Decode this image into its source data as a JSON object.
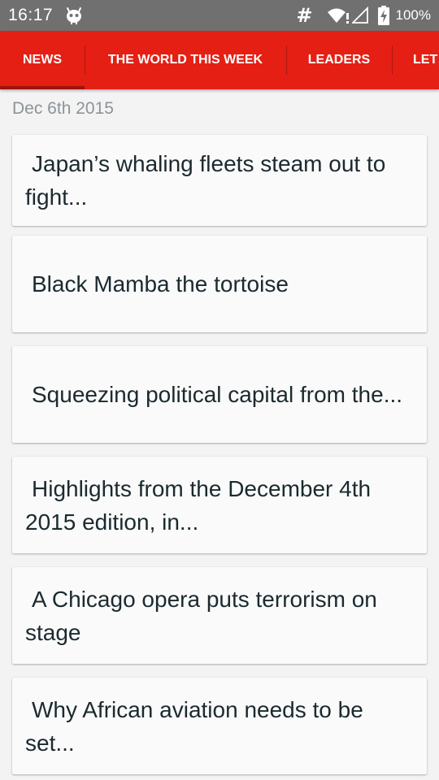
{
  "status_bar": {
    "time": "16:17",
    "app_icon": "android-debug-icon",
    "network_symbol": "#",
    "battery_percent": "100%",
    "bg_color": "#707070"
  },
  "tabs": {
    "accent_color": "#e51f14",
    "items": [
      {
        "label": "NEWS",
        "selected": true
      },
      {
        "label": "THE WORLD THIS WEEK",
        "selected": false
      },
      {
        "label": "LEADERS",
        "selected": false
      },
      {
        "label": "LET",
        "selected": false
      }
    ]
  },
  "feed": {
    "date": "Dec 6th 2015",
    "articles": [
      {
        "title": "Japan’s whaling fleets steam out to fight..."
      },
      {
        "title": "Black Mamba the tortoise"
      },
      {
        "title": "Squeezing political capital from the..."
      },
      {
        "title": "Highlights from the December 4th 2015 edition, in..."
      },
      {
        "title": "A Chicago opera puts terrorism on stage"
      },
      {
        "title": "Why African aviation needs to be set..."
      }
    ]
  }
}
